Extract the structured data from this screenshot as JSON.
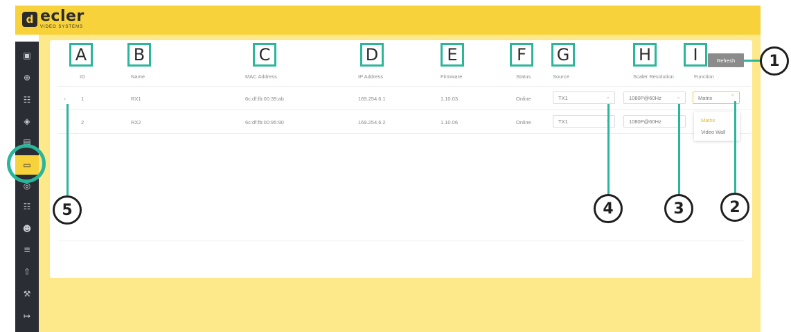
{
  "brand": {
    "name": "ecler",
    "subtitle": "VIDEO SYSTEMS",
    "mark": "d"
  },
  "toolbar": {
    "refresh_label": "Refresh"
  },
  "table": {
    "headers": [
      "ID",
      "Name",
      "MAC Address",
      "IP Address",
      "Firmware",
      "Status",
      "Source",
      "Scaler Resolution",
      "Function"
    ],
    "rows": [
      {
        "id": "1",
        "name": "RX1",
        "mac": "6c:df:fb:00:39:ab",
        "ip": "169.254.6.1",
        "firmware": "1.10.03",
        "status": "Online",
        "source": "TX1",
        "resolution": "1080P@60Hz",
        "function": "Matrix"
      },
      {
        "id": "2",
        "name": "RX2",
        "mac": "6c:df:fb:00:95:90",
        "ip": "169.254.6.2",
        "firmware": "1.10.06",
        "status": "Online",
        "source": "TX1",
        "resolution": "1080P@60Hz",
        "function": ""
      }
    ]
  },
  "function_dropdown": {
    "options": [
      "Matrix",
      "Video Wall"
    ],
    "selected": "Matrix"
  },
  "annotations": {
    "letters": [
      "A",
      "B",
      "C",
      "D",
      "E",
      "F",
      "G",
      "H",
      "I"
    ],
    "numbers": [
      "1",
      "2",
      "3",
      "4",
      "5"
    ]
  },
  "colors": {
    "brand_yellow": "#f7d23a",
    "annotation_teal": "#2bb59a",
    "sidebar": "#2a2d33"
  }
}
